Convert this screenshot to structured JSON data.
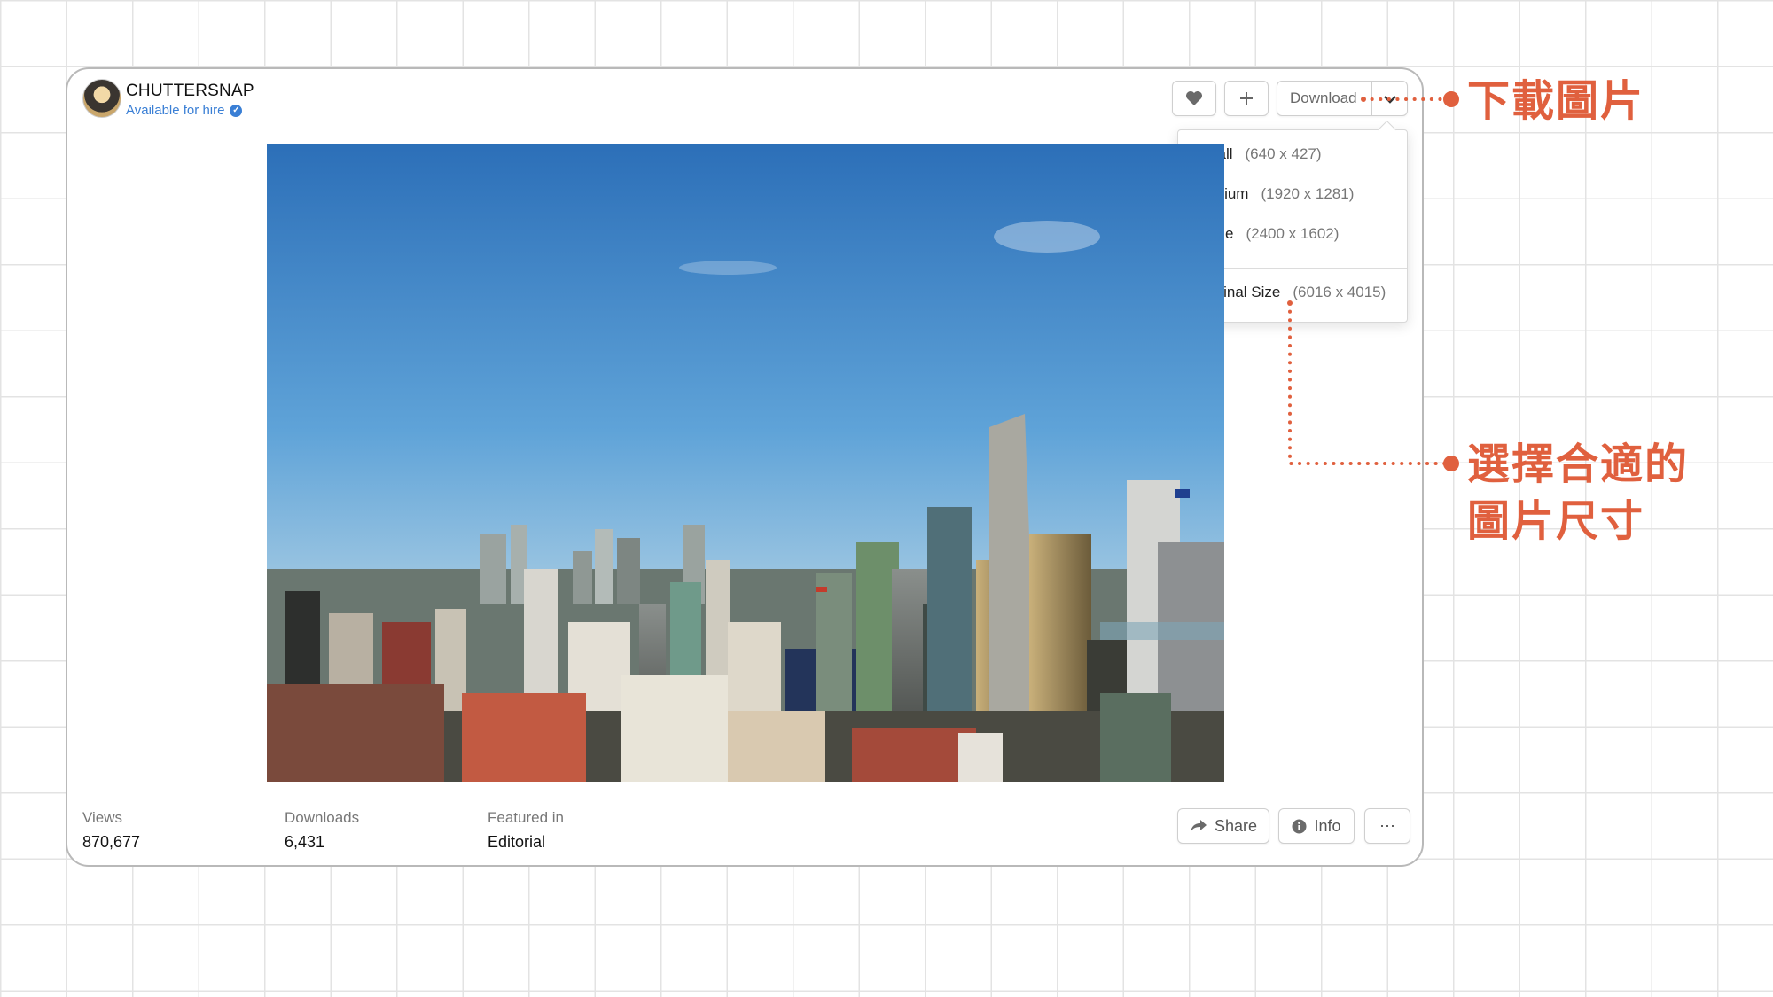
{
  "author": {
    "name": "CHUTTERSNAP",
    "status": "Available for hire",
    "verified_icon": "check-circle-icon"
  },
  "toolbar": {
    "like_icon": "heart-icon",
    "add_icon": "plus-icon",
    "download_label": "Download",
    "download_toggle_icon": "chevron-down-icon"
  },
  "download_menu": {
    "items": [
      {
        "name": "Small",
        "size": "(640 x 427)"
      },
      {
        "name": "Medium",
        "size": "(1920 x 1281)"
      },
      {
        "name": "Large",
        "size": "(2400 x 1602)"
      },
      {
        "name": "Original Size",
        "size": "(6016 x 4015)"
      }
    ]
  },
  "stats": [
    {
      "label": "Views",
      "value": "870,677"
    },
    {
      "label": "Downloads",
      "value": "6,431"
    },
    {
      "label": "Featured in",
      "value": "Editorial"
    }
  ],
  "actions": {
    "share_label": "Share",
    "share_icon": "share-arrow-icon",
    "info_label": "Info",
    "info_icon": "info-icon",
    "more_label": "⋯"
  },
  "annotations": {
    "download_note": "下載圖片",
    "size_note_line1": "選擇合適的",
    "size_note_line2": "圖片尺寸",
    "accent_color": "#e0603e"
  },
  "photo": {
    "subject": "city skyline under blue sky"
  }
}
